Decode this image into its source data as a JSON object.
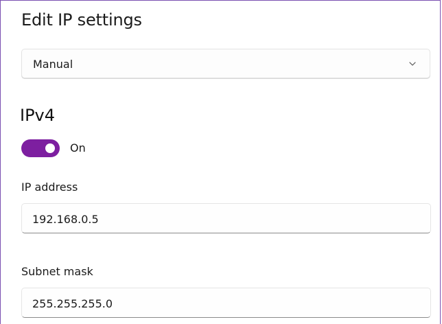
{
  "dialog": {
    "title": "Edit IP settings"
  },
  "mode_dropdown": {
    "selected": "Manual",
    "icon": "chevron-down-icon"
  },
  "ipv4": {
    "heading": "IPv4",
    "toggle_state": "On",
    "toggle_color": "#7d1fa0",
    "ip_address": {
      "label": "IP address",
      "value": "192.168.0.5"
    },
    "subnet_mask": {
      "label": "Subnet mask",
      "value": "255.255.255.0"
    }
  }
}
